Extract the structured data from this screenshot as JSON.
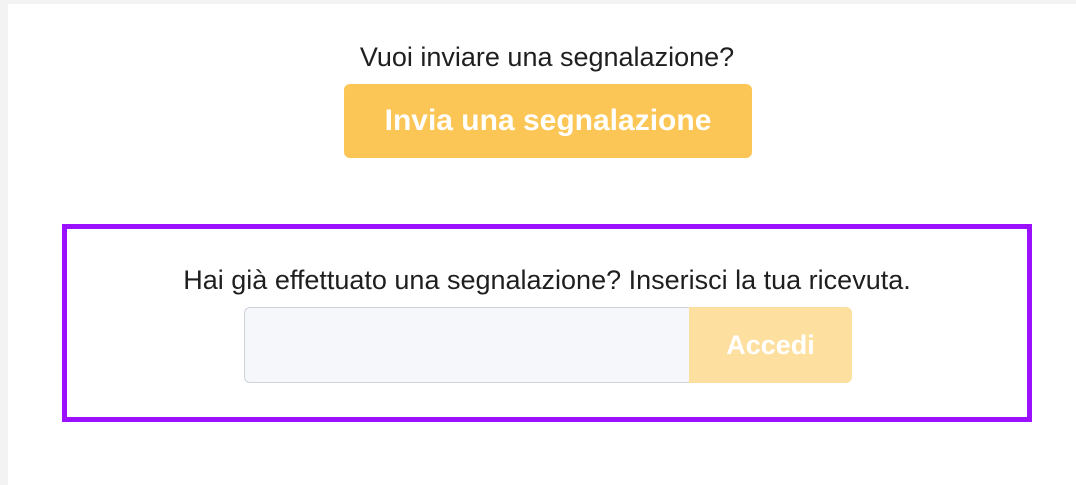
{
  "report_section": {
    "question": "Vuoi inviare una segnalazione?",
    "submit_label": "Invia una segnalazione"
  },
  "receipt_section": {
    "question": "Hai già effettuato una segnalazione? Inserisci la tua ricevuta.",
    "input_value": "",
    "input_placeholder": "",
    "login_label": "Accedi"
  },
  "colors": {
    "accent": "#fbc655",
    "accent_disabled": "#fde0a0",
    "highlight_border": "#9b10ff"
  }
}
